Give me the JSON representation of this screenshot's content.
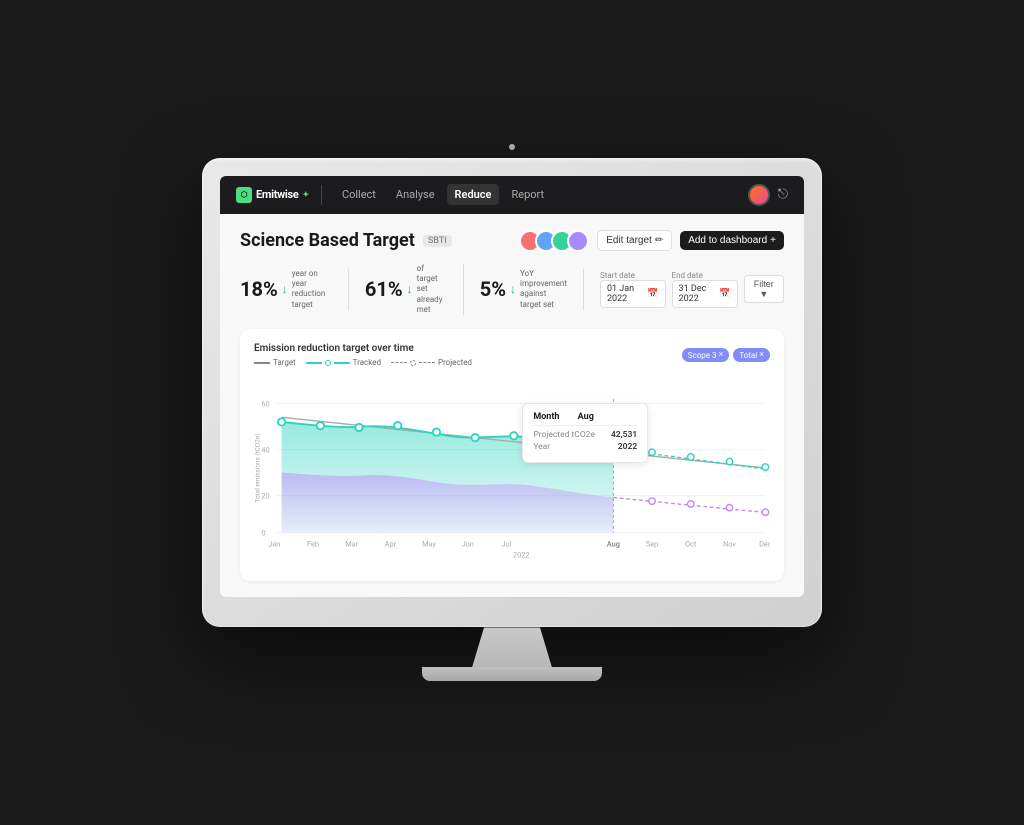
{
  "monitor": {
    "camera_label": "camera"
  },
  "nav": {
    "logo_text": "Emitwise",
    "logo_icon": "●",
    "items": [
      {
        "label": "Collect",
        "active": false
      },
      {
        "label": "Analyse",
        "active": false
      },
      {
        "label": "Reduce",
        "active": true
      },
      {
        "label": "Report",
        "active": false
      }
    ],
    "avatar_alt": "user avatar",
    "logout_icon": "⎋"
  },
  "page": {
    "title": "Science Based Target",
    "subtitle_badge": "SBTi",
    "edit_button": "Edit target",
    "add_dashboard_button": "Add to dashboard"
  },
  "stats": [
    {
      "value": "18%",
      "arrow": "↓",
      "desc_line1": "year on year",
      "desc_line2": "reduction target"
    },
    {
      "value": "61%",
      "arrow": "↓",
      "desc_line1": "of target set",
      "desc_line2": "already met"
    },
    {
      "value": "5%",
      "arrow": "↓",
      "desc_line1": "YoY improvement",
      "desc_line2": "against target set"
    }
  ],
  "date_controls": {
    "start_label": "Start date",
    "start_value": "01 Jan 2022",
    "end_label": "End date",
    "end_value": "31 Dec 2022",
    "filter_label": "Filter"
  },
  "chart": {
    "title": "Emission reduction target over time",
    "legend": [
      {
        "type": "solid",
        "color": "#888",
        "label": "Target"
      },
      {
        "type": "solid-dot",
        "color": "#2dd4bf",
        "label": "Tracked"
      },
      {
        "type": "dashed-dot",
        "color": "#888",
        "label": "Projected"
      }
    ],
    "x_axis_labels": [
      "Jan",
      "Feb",
      "Mar",
      "Apr",
      "May",
      "Jun",
      "Jul",
      "Aug",
      "Sep",
      "Oct",
      "Nov",
      "Dec"
    ],
    "x_year": "2022",
    "y_axis_labels": [
      "0",
      "20",
      "40",
      "60"
    ],
    "tags": [
      {
        "label": "Scope 3",
        "color": "purple"
      },
      {
        "label": "Total",
        "color": "purple"
      }
    ]
  },
  "tooltip": {
    "header": "Month",
    "header_val": "Aug",
    "rows": [
      {
        "key": "Projected tCO2e",
        "value": "42,531"
      },
      {
        "key": "Year",
        "value": "2022"
      }
    ]
  }
}
